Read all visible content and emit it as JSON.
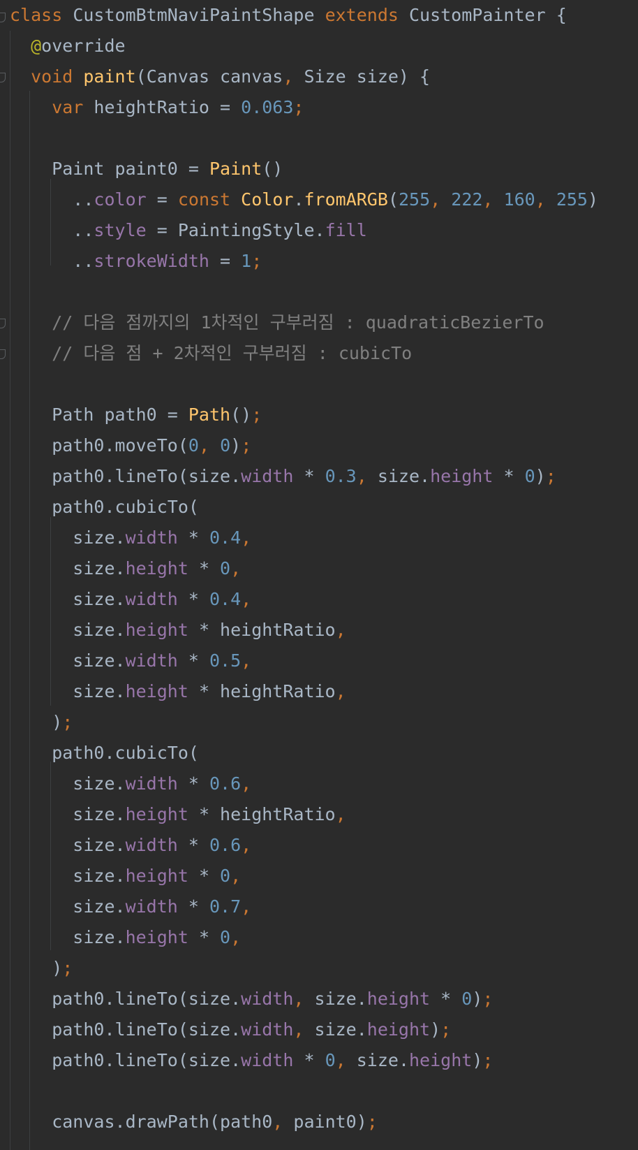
{
  "editor": {
    "language": "Dart",
    "theme": "dark",
    "colors": {
      "background": "#2b2b2b",
      "keyword": "#cc7832",
      "function": "#ffc66d",
      "number": "#6897bb",
      "field": "#9876aa",
      "annotation": "#bbb529",
      "comment": "#808080",
      "text": "#a9b7c6"
    },
    "lines": [
      [
        [
          "kw",
          "class"
        ],
        [
          "txt",
          " CustomBtmNaviPaintShape "
        ],
        [
          "kw",
          "extends"
        ],
        [
          "txt",
          " CustomPainter {"
        ]
      ],
      [
        [
          "ann",
          "  @"
        ],
        [
          "txt",
          "override"
        ]
      ],
      [
        [
          "kw",
          "  void"
        ],
        [
          "txt",
          " "
        ],
        [
          "fn",
          "paint"
        ],
        [
          "txt",
          "(Canvas canvas"
        ],
        [
          "pun",
          ","
        ],
        [
          "txt",
          " Size size) {"
        ]
      ],
      [
        [
          "kw",
          "    var"
        ],
        [
          "txt",
          " heightRatio = "
        ],
        [
          "num",
          "0.063"
        ],
        [
          "pun",
          ";"
        ]
      ],
      [],
      [
        [
          "txt",
          "    Paint paint0 = "
        ],
        [
          "fn",
          "Paint"
        ],
        [
          "txt",
          "()"
        ]
      ],
      [
        [
          "txt",
          "      .."
        ],
        [
          "fld",
          "color"
        ],
        [
          "txt",
          " = "
        ],
        [
          "kw",
          "const"
        ],
        [
          "txt",
          " "
        ],
        [
          "fn",
          "Color"
        ],
        [
          "txt",
          "."
        ],
        [
          "fn",
          "fromARGB"
        ],
        [
          "txt",
          "("
        ],
        [
          "num",
          "255"
        ],
        [
          "pun",
          ","
        ],
        [
          "txt",
          " "
        ],
        [
          "num",
          "222"
        ],
        [
          "pun",
          ","
        ],
        [
          "txt",
          " "
        ],
        [
          "num",
          "160"
        ],
        [
          "pun",
          ","
        ],
        [
          "txt",
          " "
        ],
        [
          "num",
          "255"
        ],
        [
          "txt",
          ")"
        ]
      ],
      [
        [
          "txt",
          "      .."
        ],
        [
          "fld",
          "style"
        ],
        [
          "txt",
          " = PaintingStyle."
        ],
        [
          "fld",
          "fill"
        ]
      ],
      [
        [
          "txt",
          "      .."
        ],
        [
          "fld",
          "strokeWidth"
        ],
        [
          "txt",
          " = "
        ],
        [
          "num",
          "1"
        ],
        [
          "pun",
          ";"
        ]
      ],
      [],
      [
        [
          "cmt",
          "    // 다음 점까지의 1차적인 구부러짐 : quadraticBezierTo"
        ]
      ],
      [
        [
          "cmt",
          "    // 다음 점 + 2차적인 구부러짐 : cubicTo"
        ]
      ],
      [],
      [
        [
          "txt",
          "    Path path0 = "
        ],
        [
          "fn",
          "Path"
        ],
        [
          "txt",
          "()"
        ],
        [
          "pun",
          ";"
        ]
      ],
      [
        [
          "txt",
          "    path0.moveTo("
        ],
        [
          "num",
          "0"
        ],
        [
          "pun",
          ","
        ],
        [
          "txt",
          " "
        ],
        [
          "num",
          "0"
        ],
        [
          "txt",
          ")"
        ],
        [
          "pun",
          ";"
        ]
      ],
      [
        [
          "txt",
          "    path0.lineTo(size."
        ],
        [
          "fld",
          "width"
        ],
        [
          "txt",
          " * "
        ],
        [
          "num",
          "0.3"
        ],
        [
          "pun",
          ","
        ],
        [
          "txt",
          " size."
        ],
        [
          "fld",
          "height"
        ],
        [
          "txt",
          " * "
        ],
        [
          "num",
          "0"
        ],
        [
          "txt",
          ")"
        ],
        [
          "pun",
          ";"
        ]
      ],
      [
        [
          "txt",
          "    path0.cubicTo("
        ]
      ],
      [
        [
          "txt",
          "      size."
        ],
        [
          "fld",
          "width"
        ],
        [
          "txt",
          " * "
        ],
        [
          "num",
          "0.4"
        ],
        [
          "pun",
          ","
        ]
      ],
      [
        [
          "txt",
          "      size."
        ],
        [
          "fld",
          "height"
        ],
        [
          "txt",
          " * "
        ],
        [
          "num",
          "0"
        ],
        [
          "pun",
          ","
        ]
      ],
      [
        [
          "txt",
          "      size."
        ],
        [
          "fld",
          "width"
        ],
        [
          "txt",
          " * "
        ],
        [
          "num",
          "0.4"
        ],
        [
          "pun",
          ","
        ]
      ],
      [
        [
          "txt",
          "      size."
        ],
        [
          "fld",
          "height"
        ],
        [
          "txt",
          " * heightRatio"
        ],
        [
          "pun",
          ","
        ]
      ],
      [
        [
          "txt",
          "      size."
        ],
        [
          "fld",
          "width"
        ],
        [
          "txt",
          " * "
        ],
        [
          "num",
          "0.5"
        ],
        [
          "pun",
          ","
        ]
      ],
      [
        [
          "txt",
          "      size."
        ],
        [
          "fld",
          "height"
        ],
        [
          "txt",
          " * heightRatio"
        ],
        [
          "pun",
          ","
        ]
      ],
      [
        [
          "txt",
          "    )"
        ],
        [
          "pun",
          ";"
        ]
      ],
      [
        [
          "txt",
          "    path0.cubicTo("
        ]
      ],
      [
        [
          "txt",
          "      size."
        ],
        [
          "fld",
          "width"
        ],
        [
          "txt",
          " * "
        ],
        [
          "num",
          "0.6"
        ],
        [
          "pun",
          ","
        ]
      ],
      [
        [
          "txt",
          "      size."
        ],
        [
          "fld",
          "height"
        ],
        [
          "txt",
          " * heightRatio"
        ],
        [
          "pun",
          ","
        ]
      ],
      [
        [
          "txt",
          "      size."
        ],
        [
          "fld",
          "width"
        ],
        [
          "txt",
          " * "
        ],
        [
          "num",
          "0.6"
        ],
        [
          "pun",
          ","
        ]
      ],
      [
        [
          "txt",
          "      size."
        ],
        [
          "fld",
          "height"
        ],
        [
          "txt",
          " * "
        ],
        [
          "num",
          "0"
        ],
        [
          "pun",
          ","
        ]
      ],
      [
        [
          "txt",
          "      size."
        ],
        [
          "fld",
          "width"
        ],
        [
          "txt",
          " * "
        ],
        [
          "num",
          "0.7"
        ],
        [
          "pun",
          ","
        ]
      ],
      [
        [
          "txt",
          "      size."
        ],
        [
          "fld",
          "height"
        ],
        [
          "txt",
          " * "
        ],
        [
          "num",
          "0"
        ],
        [
          "pun",
          ","
        ]
      ],
      [
        [
          "txt",
          "    )"
        ],
        [
          "pun",
          ";"
        ]
      ],
      [
        [
          "txt",
          "    path0.lineTo(size."
        ],
        [
          "fld",
          "width"
        ],
        [
          "pun",
          ","
        ],
        [
          "txt",
          " size."
        ],
        [
          "fld",
          "height"
        ],
        [
          "txt",
          " * "
        ],
        [
          "num",
          "0"
        ],
        [
          "txt",
          ")"
        ],
        [
          "pun",
          ";"
        ]
      ],
      [
        [
          "txt",
          "    path0.lineTo(size."
        ],
        [
          "fld",
          "width"
        ],
        [
          "pun",
          ","
        ],
        [
          "txt",
          " size."
        ],
        [
          "fld",
          "height"
        ],
        [
          "txt",
          ")"
        ],
        [
          "pun",
          ";"
        ]
      ],
      [
        [
          "txt",
          "    path0.lineTo(size."
        ],
        [
          "fld",
          "width"
        ],
        [
          "txt",
          " * "
        ],
        [
          "num",
          "0"
        ],
        [
          "pun",
          ","
        ],
        [
          "txt",
          " size."
        ],
        [
          "fld",
          "height"
        ],
        [
          "txt",
          ")"
        ],
        [
          "pun",
          ";"
        ]
      ],
      [],
      [
        [
          "txt",
          "    canvas.drawPath(path0"
        ],
        [
          "pun",
          ","
        ],
        [
          "txt",
          " paint0)"
        ],
        [
          "pun",
          ";"
        ]
      ]
    ]
  }
}
